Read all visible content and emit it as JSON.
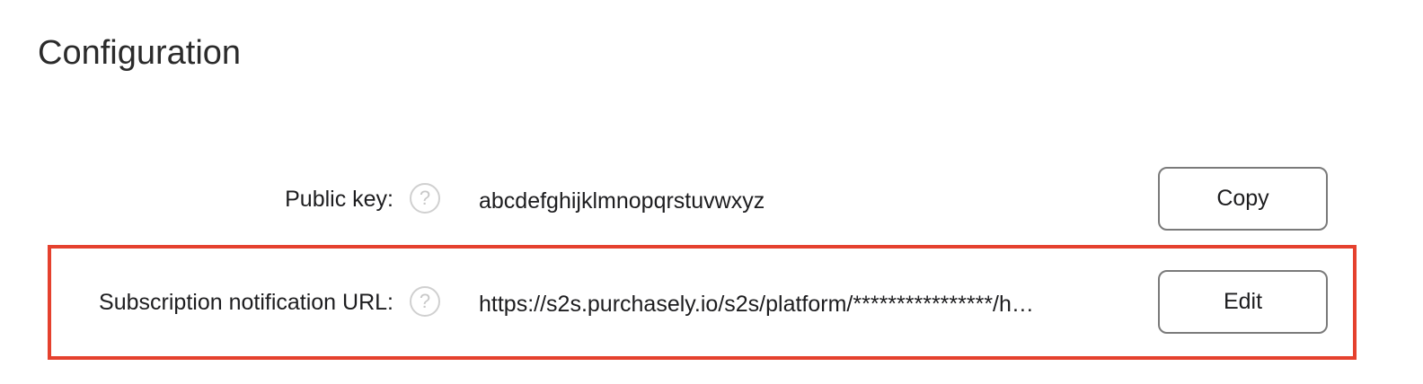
{
  "page": {
    "title": "Configuration"
  },
  "rows": {
    "public_key": {
      "label": "Public key:",
      "help_icon": "?",
      "value": "abcdefghijklmnopqrstuvwxyz",
      "button_label": "Copy"
    },
    "notification_url": {
      "label": "Subscription notification URL:",
      "help_icon": "?",
      "value": "https://s2s.purchasely.io/s2s/platform/****************/h…",
      "button_label": "Edit"
    }
  },
  "icons": {
    "help": "question-circle-icon"
  },
  "colors": {
    "highlight_border": "#e5412e",
    "button_border": "#7a7a7a",
    "help_icon": "#c8c8c8",
    "text": "#1d1d1f"
  }
}
